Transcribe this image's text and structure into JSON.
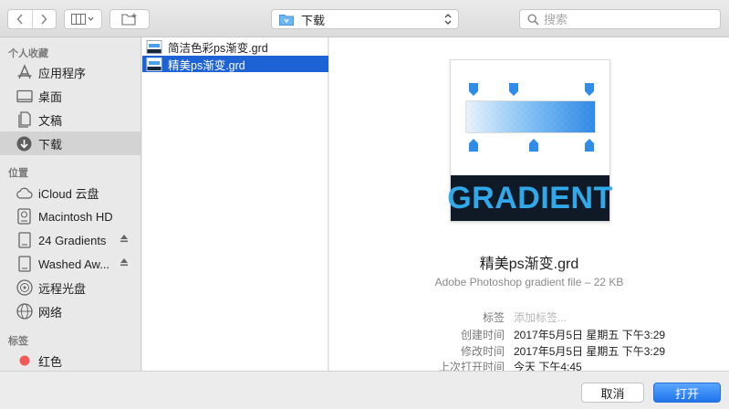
{
  "toolbar": {
    "location": "下载",
    "search_placeholder": "搜索",
    "back_icon": "chevron-left-icon",
    "forward_icon": "chevron-right-icon",
    "view_icon": "column-view-icon",
    "new_folder_icon": "new-folder-icon"
  },
  "sidebar": {
    "favorites_title": "个人收藏",
    "favorites": [
      {
        "label": "应用程序",
        "icon": "applications-icon"
      },
      {
        "label": "桌面",
        "icon": "desktop-icon"
      },
      {
        "label": "文稿",
        "icon": "documents-icon"
      },
      {
        "label": "下载",
        "icon": "downloads-icon",
        "selected": true
      }
    ],
    "locations_title": "位置",
    "locations": [
      {
        "label": "iCloud 云盘",
        "icon": "cloud-icon"
      },
      {
        "label": "Macintosh HD",
        "icon": "hard-drive-icon"
      },
      {
        "label": "24 Gradients",
        "icon": "disk-image-icon",
        "eject": true
      },
      {
        "label": "Washed Aw...",
        "icon": "disk-image-icon",
        "eject": true
      },
      {
        "label": "远程光盘",
        "icon": "optical-disc-icon"
      },
      {
        "label": "网络",
        "icon": "network-icon"
      }
    ],
    "tags_title": "标签",
    "tags": [
      {
        "label": "红色",
        "color": "#f25a55"
      }
    ]
  },
  "files": [
    {
      "name": "简洁色彩ps渐变.grd",
      "selected": false
    },
    {
      "name": "精美ps渐变.grd",
      "selected": true
    }
  ],
  "preview": {
    "thumbnail_text": "GRADIENT",
    "filename": "精美ps渐变.grd",
    "kind": "Adobe Photoshop gradient file – 22 KB",
    "meta": [
      {
        "label": "标签",
        "value": "添加标签...",
        "placeholder": true
      },
      {
        "label": "创建时间",
        "value": "2017年5月5日 星期五 下午3:29"
      },
      {
        "label": "修改时间",
        "value": "2017年5月5日 星期五 下午3:29"
      },
      {
        "label": "上次打开时间",
        "value": "今天 下午4:45"
      }
    ]
  },
  "footer": {
    "cancel_label": "取消",
    "open_label": "打开"
  },
  "colors": {
    "selection": "#1e63d6",
    "accent_button": "#1e74ec",
    "gradient_blue": "#1b7fe4"
  }
}
